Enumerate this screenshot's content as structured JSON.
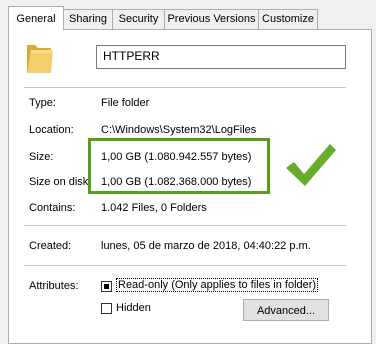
{
  "tabs": [
    {
      "label": "General"
    },
    {
      "label": "Sharing"
    },
    {
      "label": "Security"
    },
    {
      "label": "Previous Versions"
    },
    {
      "label": "Customize"
    }
  ],
  "name": "HTTPERR",
  "props": {
    "type": {
      "label": "Type:",
      "value": "File folder"
    },
    "location": {
      "label": "Location:",
      "value": "C:\\Windows\\System32\\LogFiles"
    },
    "size": {
      "label": "Size:",
      "value": "1,00 GB (1.080.942.557 bytes)"
    },
    "size_on_disk": {
      "label": "Size on disk:",
      "value": "1,00 GB (1.082.368.000 bytes)"
    },
    "contains": {
      "label": "Contains:",
      "value": "1.042 Files, 0 Folders"
    },
    "created": {
      "label": "Created:",
      "value": "lunes, 05 de marzo de 2018, 04:40:22 p.m."
    }
  },
  "attributes": {
    "label": "Attributes:",
    "readonly_label": "Read-only (Only applies to files in folder)",
    "readonly_state": "indeterminate",
    "hidden_label": "Hidden",
    "hidden_checked": false,
    "advanced_label": "Advanced..."
  },
  "colors": {
    "highlight": "#5a9a1e",
    "checkmark": "#66ad2e",
    "folder": "#e8c35a"
  }
}
